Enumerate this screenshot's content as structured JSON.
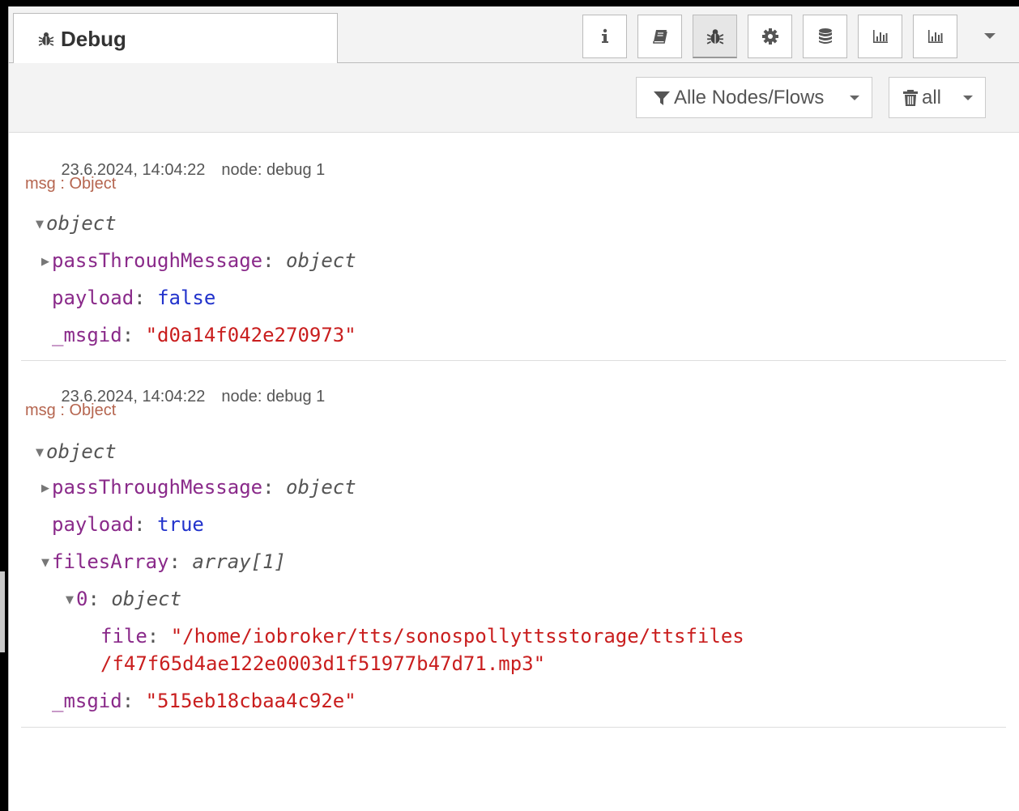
{
  "tab": {
    "label": "Debug",
    "icon": "bug-icon"
  },
  "toolbar": {
    "buttons": [
      {
        "name": "info",
        "icon": "info-icon"
      },
      {
        "name": "help",
        "icon": "book-icon"
      },
      {
        "name": "debug",
        "icon": "bug-icon",
        "active": true
      },
      {
        "name": "config",
        "icon": "gear-icon"
      },
      {
        "name": "context",
        "icon": "database-icon"
      },
      {
        "name": "dashboard",
        "icon": "bar-chart-icon"
      },
      {
        "name": "dashboard-2",
        "icon": "bar-chart-icon"
      }
    ]
  },
  "filters": {
    "nodes_label": "Alle Nodes/Flows",
    "clear_label": "all"
  },
  "messages": [
    {
      "timestamp": "23.6.2024, 14:04:22",
      "node": "node: debug 1",
      "topic": "msg : Object",
      "root_type": "object",
      "passThrough_key": "passThroughMessage",
      "passThrough_type": "object",
      "payload_key": "payload",
      "payload_value": "false",
      "msgid_key": "_msgid",
      "msgid_value": "\"d0a14f042e270973\""
    },
    {
      "timestamp": "23.6.2024, 14:04:22",
      "node": "node: debug 1",
      "topic": "msg : Object",
      "root_type": "object",
      "passThrough_key": "passThroughMessage",
      "passThrough_type": "object",
      "payload_key": "payload",
      "payload_value": "true",
      "files_key": "filesArray",
      "files_type": "array[1]",
      "item_key": "0",
      "item_type": "object",
      "file_key": "file",
      "file_value_line1": "\"/home/iobroker/tts/sonospollyttsstorage/ttsfiles",
      "file_value_line2": "/f47f65d4ae122e0003d1f51977b47d71.mp3\"",
      "msgid_key": "_msgid",
      "msgid_value": "\"515eb18cbaa4c92e\""
    }
  ],
  "colors": {
    "key": "#8a2a8a",
    "string": "#c91e1e",
    "boolean": "#2233cc",
    "topic": "#b5654f"
  }
}
